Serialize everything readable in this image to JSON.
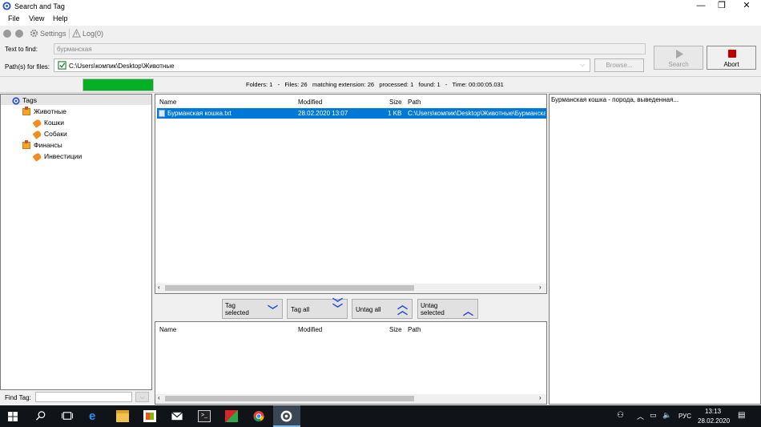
{
  "window": {
    "title": "Search and Tag",
    "minimize": "—",
    "restore": "❐",
    "close": "✕"
  },
  "menu": [
    "File",
    "View",
    "Help"
  ],
  "toolbar": {
    "settings": "Settings",
    "log": "Log(0)"
  },
  "form": {
    "text_label": "Text to find:",
    "text_value": "бурманская",
    "path_label": "Path(s) for files:",
    "path_value": "C:\\Users\\компик\\Desktop\\Животные",
    "browse_label": "Browse...",
    "search_label": "Search",
    "abort_label": "Abort"
  },
  "status": {
    "progress": 1.0,
    "text": "Folders: 1   -   Files: 26   matching extension: 26   processed: 1   found: 1   -   Time: 00:00:05.031"
  },
  "tree": {
    "root": "Tags",
    "groups": [
      {
        "label": "Животные",
        "children": [
          "Кошки",
          "Собаки"
        ]
      },
      {
        "label": "Финансы",
        "children": [
          "Инвестиции"
        ]
      }
    ]
  },
  "find_tag_label": "Find Tag:",
  "results": {
    "columns": {
      "name": "Name",
      "modified": "Modified",
      "size": "Size",
      "path": "Path"
    },
    "rows": [
      {
        "name": "Бурманская кошка.txt",
        "modified": "28.02.2020 13:07",
        "size": "1 KB",
        "path": "C:\\Users\\компик\\Desktop\\Животные\\Бурманска"
      }
    ]
  },
  "tag_buttons": {
    "tag_selected": "Tag\nselected",
    "tag_all": "Tag all",
    "untag_all": "Untag all",
    "untag_selected": "Untag\nselected"
  },
  "lower_columns": {
    "name": "Name",
    "modified": "Modified",
    "size": "Size",
    "path": "Path"
  },
  "preview_text": "Бурманская кошка - порода, выведенная...",
  "taskbar": {
    "lang": "РУС",
    "time": "13:13",
    "date": "28.02.2020"
  },
  "colors": {
    "accent_select": "#0078d7",
    "progress": "#06b025",
    "abort_red": "#c00000",
    "taskbar": "#101418"
  }
}
